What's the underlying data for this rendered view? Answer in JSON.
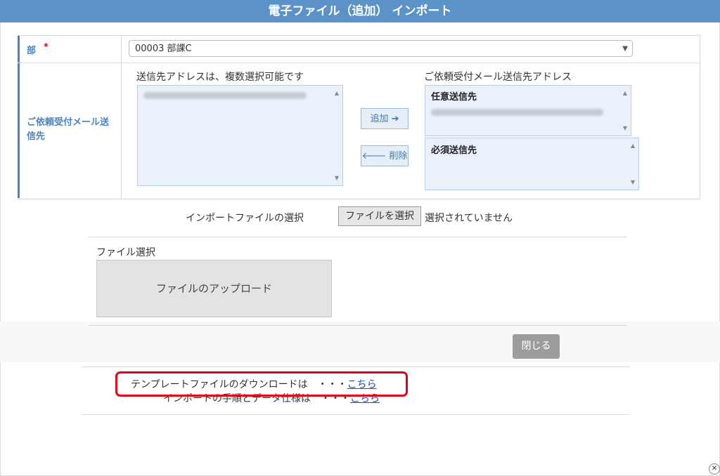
{
  "title": "電子ファイル（追加） インポート",
  "form": {
    "dept_label": "部",
    "required_mark": "*",
    "dept_value": "00003 部課C",
    "mail_label": "ご依頼受付メール送信先",
    "source_hint": "送信先アドレスは、複数選択可能です",
    "dest_hint": "ご依頼受付メール送信先アドレス",
    "add_button": "追加 ➔",
    "remove_button": "🡐 削除",
    "optional_header": "任意送信先",
    "required_header": "必須送信先"
  },
  "import": {
    "label": "インポートファイルの選択",
    "choose_button": "ファイルを選択",
    "no_file": "選択されていません"
  },
  "upload": {
    "section_label": "ファイル選択",
    "dropzone_text": "ファイルのアップロード"
  },
  "close_button": "閉じる",
  "links": {
    "template_text": "テンプレートファイルのダウンロードは　・・・",
    "template_link": "こちら",
    "manual_text": "インポートの手順とデータ仕様は　・・・",
    "manual_link": "こちら"
  },
  "colors": {
    "titlebar": "#5b93c9",
    "label_accent": "#4a82c0",
    "highlight": "#e2001a"
  }
}
